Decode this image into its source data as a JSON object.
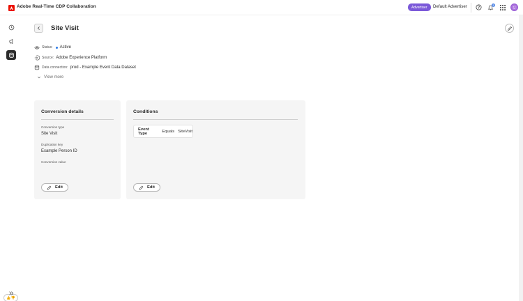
{
  "header": {
    "app_title": "Adobe Real-Time CDP Collaboration",
    "advertiser_badge": "Advertiser",
    "advertiser_name": "Default Advertiser",
    "notification_count": "1",
    "icons": [
      "help-icon",
      "bell-icon",
      "apps-grid-icon",
      "user-avatar"
    ]
  },
  "colors": {
    "accent": "#7b59d9",
    "status_active": "#2e7ce8",
    "brand_red": "#eb1000"
  },
  "sidebar": {
    "items": [
      {
        "icon": "history-icon",
        "active": false
      },
      {
        "icon": "announcement-icon",
        "active": false
      },
      {
        "icon": "data-connections-icon",
        "active": true
      }
    ],
    "feedback_label": "👍👎",
    "expand_icon": "chevron-double-right-icon"
  },
  "page": {
    "title": "Site Visit",
    "meta": {
      "status_label": "Status:",
      "status_value": "Active",
      "source_label": "Source:",
      "source_value": "Adobe Experience Platform",
      "connection_label": "Data connection:",
      "connection_value": "prod - Example Event Data Dataset"
    },
    "view_more": "View more"
  },
  "conversion_details": {
    "title": "Conversion details",
    "fields": [
      {
        "label": "Conversion type",
        "value": "Site Visit"
      },
      {
        "label": "Duplication key",
        "value": "Example Person ID"
      },
      {
        "label": "Conversion value",
        "value": ""
      }
    ],
    "edit_label": "Edit"
  },
  "conditions": {
    "title": "Conditions",
    "rule": {
      "key": "Event Type",
      "operator": "Equals",
      "value": "SiteVisit"
    },
    "edit_label": "Edit"
  }
}
